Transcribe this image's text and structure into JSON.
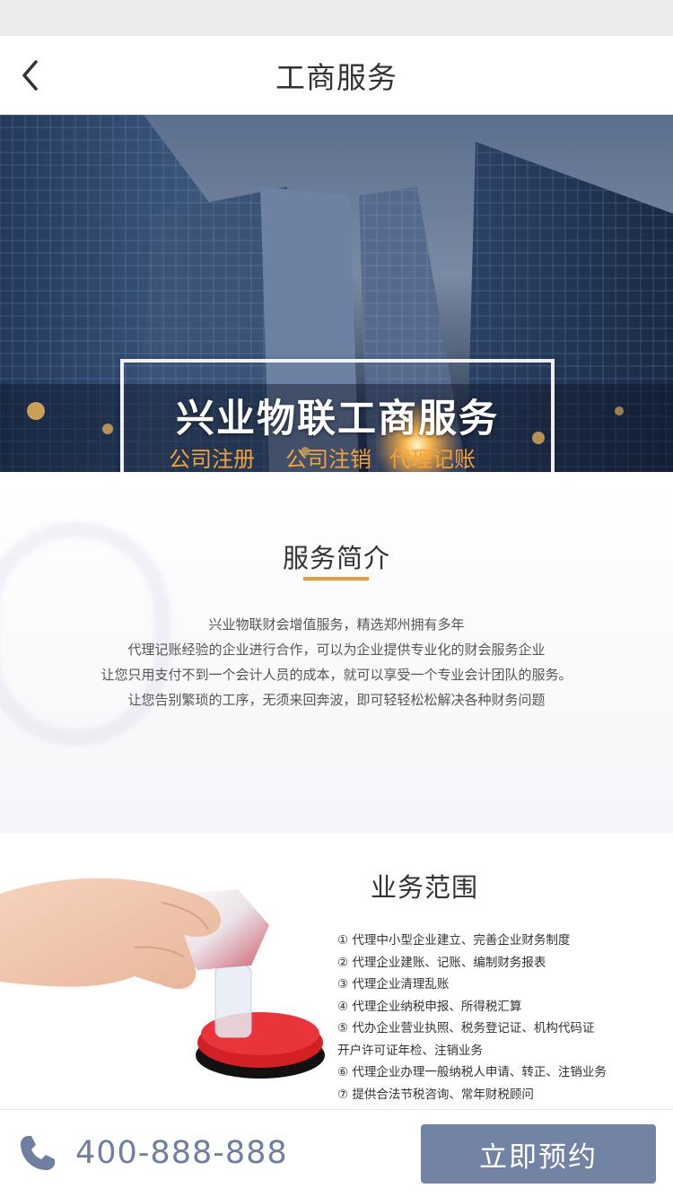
{
  "nav": {
    "title": "工商服务",
    "back_icon": "back-chevron-icon"
  },
  "banner": {
    "headline": "兴业物联工商服务",
    "tags": [
      "公司注册",
      "公司注销",
      "代理记账"
    ],
    "tag_color": "#f2a33a"
  },
  "intro": {
    "title": "服务简介",
    "lines": [
      "兴业物联财会增值服务，精选郑州拥有多年",
      "代理记账经验的企业进行合作，可以为企业提供专业化的财会服务企业",
      "让您只用支付不到一个会计人员的成本，就可以享受一个专业会计团队的服务。",
      "让您告别繁琐的工序，无须来回奔波，即可轻轻松松解决各种财务问题"
    ]
  },
  "scope": {
    "title": "业务范围",
    "items": [
      "① 代理中小型企业建立、完善企业财务制度",
      "② 代理企业建账、记账、编制财务报表",
      "③ 代理企业清理乱账",
      "④ 代理企业纳税申报、所得税汇算",
      "⑤ 代办企业营业执照、税务登记证、机构代码证",
      "开户许可证年检、注销业务",
      "⑥ 代理企业办理一般纳税人申请、转正、注销业务",
      "⑦ 提供合法节税咨询、常年财税顾问"
    ]
  },
  "footer": {
    "phone_icon": "phone-icon",
    "phone": "400-888-888",
    "book_label": "立即预约",
    "accent": "#7283a4"
  }
}
